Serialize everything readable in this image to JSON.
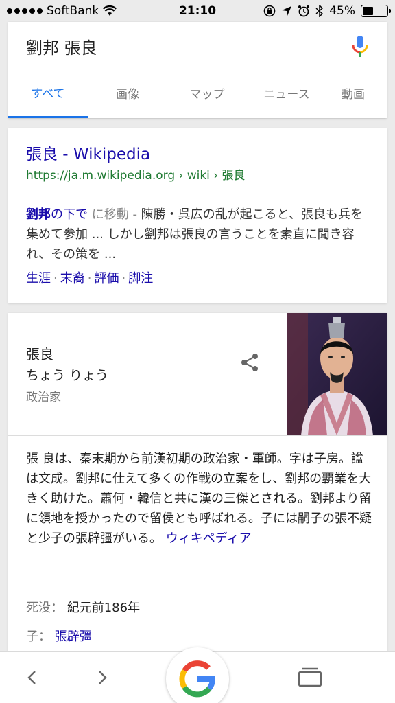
{
  "status_bar": {
    "carrier": "SoftBank",
    "time": "21:10",
    "battery_percent": "45%",
    "battery_level": 0.45
  },
  "search": {
    "query": "劉邦 張良",
    "tabs": [
      "すべて",
      "画像",
      "マップ",
      "ニュース",
      "動画"
    ]
  },
  "result": {
    "title": "張良 - Wikipedia",
    "url": "https://ja.m.wikipedia.org › wiki › 張良",
    "snippet_hl": "劉邦",
    "snippet_jump": "の下で",
    "snippet_jump_gray": " に移動 - ",
    "snippet_text": "陳勝・呉広の乱が起こると、張良も兵を集めて参加 ... しかし劉邦は張良の言うことを素直に聞き容れ、その策を ...",
    "sitelinks": [
      "生涯",
      "末裔",
      "評価",
      "脚注"
    ],
    "sitelink_sep": "·"
  },
  "knowledge_panel": {
    "name": "張良",
    "reading": "ちょう りょう",
    "type": "政治家",
    "description": "張 良は、秦末期から前漢初期の政治家・軍師。字は子房。諡は文成。劉邦に仕えて多くの作戦の立案をし、劉邦の覇業を大きく助けた。蕭何・韓信と共に漢の三傑とされる。劉邦より留に領地を授かったので留侯とも呼ばれる。子には嗣子の張不疑と少子の張辟彊がいる。",
    "wiki_link": "ウィキペディア",
    "facts": [
      {
        "label": "死没：",
        "value": "紀元前186年"
      },
      {
        "label": "子：",
        "value": "張辟彊"
      }
    ]
  },
  "icons": {
    "wifi": "wifi-icon",
    "lock_rotation": "orientation-lock-icon",
    "location": "location-arrow-icon",
    "alarm": "alarm-icon",
    "bluetooth": "bluetooth-icon",
    "mic": "mic-icon",
    "share": "share-icon",
    "back": "chevron-left-icon",
    "forward": "chevron-right-icon",
    "google": "google-g-icon",
    "tabs": "tabs-icon"
  },
  "colors": {
    "accent": "#1a73e8",
    "link": "#1a0dab",
    "url": "#1f7a32"
  }
}
